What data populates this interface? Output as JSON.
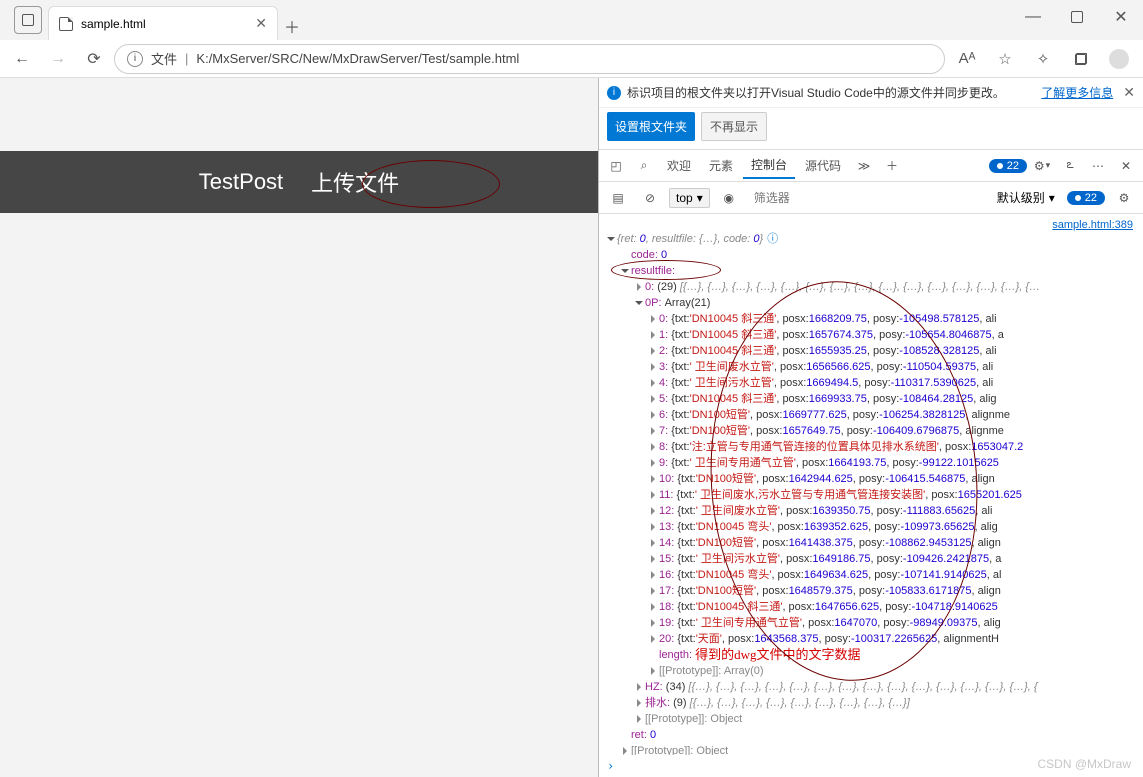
{
  "titlebar": {
    "tab_title": "sample.html"
  },
  "addr": {
    "scheme_label": "文件",
    "sep": "|",
    "path": "K:/MxServer/SRC/New/MxDrawServer/Test/sample.html",
    "aa": "Aᴬ"
  },
  "page": {
    "testpost": "TestPost",
    "upload": "上传文件"
  },
  "info": {
    "msg": "标识项目的根文件夹以打开Visual Studio Code中的源文件并同步更改。",
    "link": "了解更多信息",
    "btn_set": "设置根文件夹",
    "btn_hide": "不再显示"
  },
  "dev": {
    "tabs": {
      "welcome": "欢迎",
      "elements": "元素",
      "console": "控制台",
      "sources": "源代码"
    },
    "badge": "22",
    "cbar": {
      "top": "top",
      "filter_placeholder": "筛选器",
      "default": "默认级别",
      "badge": "22"
    },
    "src": "sample.html:389"
  },
  "console": {
    "header": {
      "ret_k": "{ret:",
      "ret_v": "0",
      "rf_k": ", resultfile:",
      "rf_v": "{…}",
      "code_k": ", code:",
      "code_v": "0",
      "end": "}"
    },
    "code_line": {
      "k": "code:",
      "v": "0"
    },
    "rf_line": "resultfile:",
    "zero": {
      "k": "0:",
      "count": "(29)",
      "items": "[{…}, {…}, {…}, {…}, {…}, {…}, {…}, {…}, {…}, {…}, {…}, {…}, {…}, {…}, {…"
    },
    "zeroP": {
      "k": "0P:",
      "v": "Array(21)"
    },
    "items": [
      {
        "i": "0",
        "txt": "'DN10045 斜三通'",
        "x": "1668209.75",
        "y": "-105498.578125",
        "tail": "ali"
      },
      {
        "i": "1",
        "txt": "'DN10045 斜三通'",
        "x": "1657674.375",
        "y": "-105654.8046875",
        "tail": "a"
      },
      {
        "i": "2",
        "txt": "'DN10045 斜三通'",
        "x": "1655935.25",
        "y": "-108528.328125",
        "tail": "ali"
      },
      {
        "i": "3",
        "txt": "' 卫生间废水立管'",
        "x": "1656566.625",
        "y": "-110504.59375",
        "tail": "ali"
      },
      {
        "i": "4",
        "txt": "' 卫生间污水立管'",
        "x": "1669494.5",
        "y": "-110317.5390625",
        "tail": "ali"
      },
      {
        "i": "5",
        "txt": "'DN10045 斜三通'",
        "x": "1669933.75",
        "y": "-108464.28125",
        "tail": "alig"
      },
      {
        "i": "6",
        "txt": "'DN100短管'",
        "x": "1669777.625",
        "y": "-106254.3828125",
        "tail": "alignme"
      },
      {
        "i": "7",
        "txt": "'DN100短管'",
        "x": "1657649.75",
        "y": "-106409.6796875",
        "tail": "alignme"
      },
      {
        "i": "8",
        "txt": "'注:立管与专用通气管连接的位置具体见排水系统图'",
        "x": "1653047.2",
        "y": "",
        "tail": ""
      },
      {
        "i": "9",
        "txt": "' 卫生间专用通气立管'",
        "x": "1664193.75",
        "y": "-99122.1015625",
        "tail": ""
      },
      {
        "i": "10",
        "txt": "'DN100短管'",
        "x": "1642944.625",
        "y": "-106415.546875",
        "tail": "align"
      },
      {
        "i": "11",
        "txt": "' 卫生间废水,污水立管与专用通气管连接安装图'",
        "x": "1655201.625",
        "y": "",
        "tail": ""
      },
      {
        "i": "12",
        "txt": "' 卫生间废水立管'",
        "x": "1639350.75",
        "y": "-111883.65625",
        "tail": "ali"
      },
      {
        "i": "13",
        "txt": "'DN10045 弯头'",
        "x": "1639352.625",
        "y": "-109973.65625",
        "tail": "alig"
      },
      {
        "i": "14",
        "txt": "'DN100短管'",
        "x": "1641438.375",
        "y": "-108862.9453125",
        "tail": "align"
      },
      {
        "i": "15",
        "txt": "' 卫生间污水立管'",
        "x": "1649186.75",
        "y": "-109426.2421875",
        "tail": "a"
      },
      {
        "i": "16",
        "txt": "'DN10045 弯头'",
        "x": "1649634.625",
        "y": "-107141.9140625",
        "tail": "al"
      },
      {
        "i": "17",
        "txt": "'DN100短管'",
        "x": "1648579.375",
        "y": "-105833.6171875",
        "tail": "align"
      },
      {
        "i": "18",
        "txt": "'DN10045 斜三通'",
        "x": "1647656.625",
        "y": "-104718.9140625",
        "tail": ""
      },
      {
        "i": "19",
        "txt": "' 卫生间专用通气立管'",
        "x": "1647070",
        "y": "-98949.09375",
        "tail": "alig"
      },
      {
        "i": "20",
        "txt": "'天面'",
        "x": "1643568.375",
        "y": "-100317.2265625",
        "tail": "alignmentH"
      }
    ],
    "annotation": "得到的dwg文件中的文字数据",
    "len": {
      "k": "length:",
      "v": "21"
    },
    "proto_arr": "[[Prototype]]: Array(0)",
    "HZ": {
      "k": "HZ:",
      "count": "(34)",
      "items": "[{…}, {…}, {…}, {…}, {…}, {…}, {…}, {…}, {…}, {…}, {…}, {…}, {…}, {…}, {"
    },
    "pw": {
      "k": "排水:",
      "count": "(9)",
      "items": "[{…}, {…}, {…}, {…}, {…}, {…}, {…}, {…}, {…}]"
    },
    "proto_obj": "[[Prototype]]: Object",
    "ret_line": {
      "k": "ret:",
      "v": "0"
    }
  },
  "watermark": "CSDN @MxDraw"
}
